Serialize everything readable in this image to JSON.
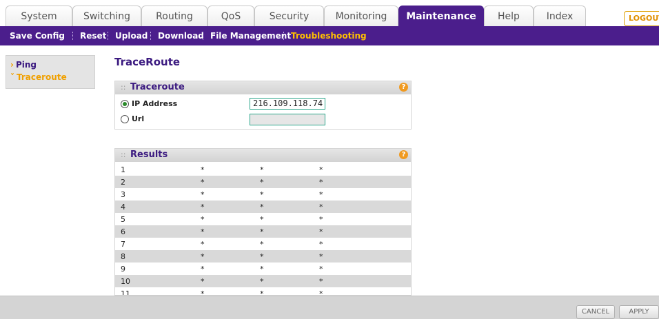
{
  "top_tabs": [
    {
      "label": "System"
    },
    {
      "label": "Switching"
    },
    {
      "label": "Routing"
    },
    {
      "label": "QoS"
    },
    {
      "label": "Security"
    },
    {
      "label": "Monitoring"
    },
    {
      "label": "Maintenance"
    },
    {
      "label": "Help"
    },
    {
      "label": "Index"
    }
  ],
  "active_tab": "Maintenance",
  "logout_label": "LOGOUT",
  "sub_menu": [
    {
      "label": "Save Config"
    },
    {
      "label": "Reset"
    },
    {
      "label": "Upload"
    },
    {
      "label": "Download"
    },
    {
      "label": "File Management"
    },
    {
      "label": "Troubleshooting"
    }
  ],
  "active_sub": "Troubleshooting",
  "left_nav": [
    {
      "label": "Ping",
      "marker": "›"
    },
    {
      "label": "Traceroute",
      "marker": "˅"
    }
  ],
  "page_title": "TraceRoute",
  "traceroute_panel": {
    "title": "Traceroute",
    "help": "?",
    "ip_label": "IP Address",
    "ip_value": "216.109.118.74",
    "url_label": "Url",
    "url_value": "",
    "selected": "ip"
  },
  "results_panel": {
    "title": "Results",
    "help": "?",
    "rows": [
      [
        "1",
        "*",
        "*",
        "*"
      ],
      [
        "2",
        "*",
        "*",
        "*"
      ],
      [
        "3",
        "*",
        "*",
        "*"
      ],
      [
        "4",
        "*",
        "*",
        "*"
      ],
      [
        "5",
        "*",
        "*",
        "*"
      ],
      [
        "6",
        "*",
        "*",
        "*"
      ],
      [
        "7",
        "*",
        "*",
        "*"
      ],
      [
        "8",
        "*",
        "*",
        "*"
      ],
      [
        "9",
        "*",
        "*",
        "*"
      ],
      [
        "10",
        "*",
        "*",
        "*"
      ],
      [
        "11",
        "*",
        "*",
        "*"
      ]
    ]
  },
  "buttons": {
    "cancel": "CANCEL",
    "apply": "APPLY"
  },
  "colors": {
    "brand_purple": "#4b1e8c",
    "accent_orange": "#f0a000"
  }
}
